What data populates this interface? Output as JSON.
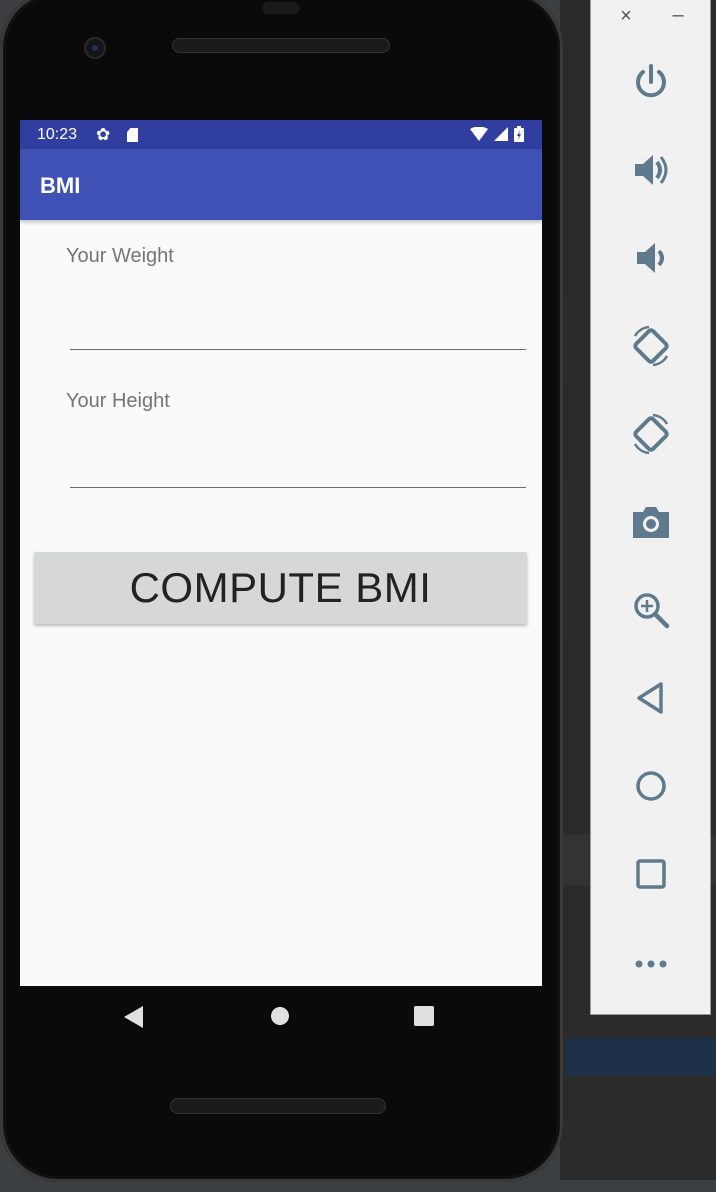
{
  "status_bar": {
    "time": "10:23",
    "settings_icon": "gear-icon",
    "sd_icon": "sd-card-icon",
    "wifi_icon": "wifi-icon",
    "signal_icon": "cell-signal-icon",
    "battery_icon": "battery-charging-icon"
  },
  "app_bar": {
    "title": "BMI"
  },
  "form": {
    "weight_label": "Your Weight",
    "weight_value": "",
    "height_label": "Your Height",
    "height_value": "",
    "compute_button": "COMPUTE BMI"
  },
  "nav_bar": {
    "back_icon": "back-triangle-icon",
    "home_icon": "home-circle-icon",
    "recents_icon": "recents-square-icon"
  },
  "emulator_toolbar": {
    "close": "×",
    "minimize": "–",
    "buttons": [
      "power-icon",
      "volume-up-icon",
      "volume-down-icon",
      "rotate-left-icon",
      "rotate-right-icon",
      "camera-icon",
      "zoom-icon",
      "back-icon",
      "home-icon",
      "overview-icon",
      "more-icon"
    ]
  },
  "colors": {
    "primary": "#3f51b5",
    "primary_dark": "#303f9f",
    "button_bg": "#d6d7d7",
    "icon_color": "#5f7a8c"
  }
}
